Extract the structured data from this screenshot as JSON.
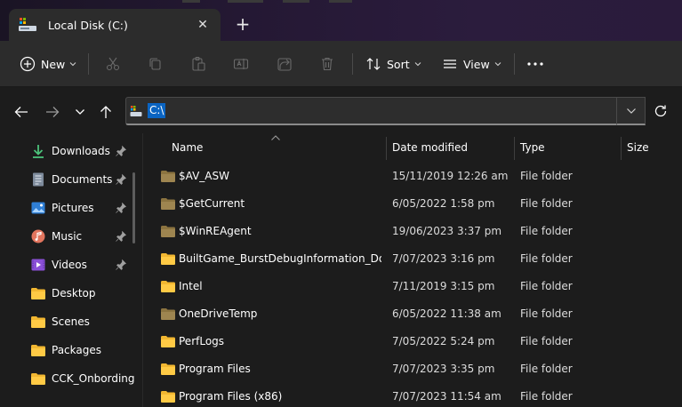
{
  "window": {
    "tab_title": "Local Disk (C:)",
    "tab_close": "✕",
    "new_tab": "+"
  },
  "colors": {
    "accent": "#0a64c2",
    "folder_yellow": "#f2b731",
    "folder_dim": "#8c7440",
    "background": "#1c1c1c"
  },
  "toolbar": {
    "new_label": "New",
    "sort_label": "Sort",
    "view_label": "View",
    "icons": [
      "cut-icon",
      "copy-icon",
      "paste-icon",
      "rename-icon",
      "share-icon",
      "delete-icon",
      "more-icon"
    ]
  },
  "address": {
    "path": "C:\\"
  },
  "sidebar": {
    "items": [
      {
        "label": "Downloads",
        "icon": "download-icon",
        "pinned": true
      },
      {
        "label": "Documents",
        "icon": "document-icon",
        "pinned": true
      },
      {
        "label": "Pictures",
        "icon": "picture-icon",
        "pinned": true
      },
      {
        "label": "Music",
        "icon": "music-icon",
        "pinned": true
      },
      {
        "label": "Videos",
        "icon": "video-icon",
        "pinned": true
      },
      {
        "label": "Desktop",
        "icon": "folder-icon",
        "pinned": false
      },
      {
        "label": "Scenes",
        "icon": "folder-icon",
        "pinned": false
      },
      {
        "label": "Packages",
        "icon": "folder-icon",
        "pinned": false
      },
      {
        "label": "CCK_Onbording",
        "icon": "folder-icon",
        "pinned": false
      }
    ]
  },
  "columns": {
    "name": "Name",
    "date": "Date modified",
    "type": "Type",
    "size": "Size"
  },
  "files": [
    {
      "name": "$AV_ASW",
      "date": "15/11/2019 12:26 am",
      "type": "File folder",
      "hidden": true
    },
    {
      "name": "$GetCurrent",
      "date": "6/05/2022 1:58 pm",
      "type": "File folder",
      "hidden": true
    },
    {
      "name": "$WinREAgent",
      "date": "19/06/2023 3:37 pm",
      "type": "File folder",
      "hidden": true
    },
    {
      "name": "BuiltGame_BurstDebugInformation_DoN...",
      "date": "7/07/2023 3:16 pm",
      "type": "File folder",
      "hidden": false
    },
    {
      "name": "Intel",
      "date": "7/11/2019 3:15 pm",
      "type": "File folder",
      "hidden": false
    },
    {
      "name": "OneDriveTemp",
      "date": "6/05/2022 11:38 am",
      "type": "File folder",
      "hidden": true
    },
    {
      "name": "PerfLogs",
      "date": "7/05/2022 5:24 pm",
      "type": "File folder",
      "hidden": false
    },
    {
      "name": "Program Files",
      "date": "7/07/2023 3:35 pm",
      "type": "File folder",
      "hidden": false
    },
    {
      "name": "Program Files (x86)",
      "date": "7/07/2023 11:54 am",
      "type": "File folder",
      "hidden": false
    }
  ]
}
